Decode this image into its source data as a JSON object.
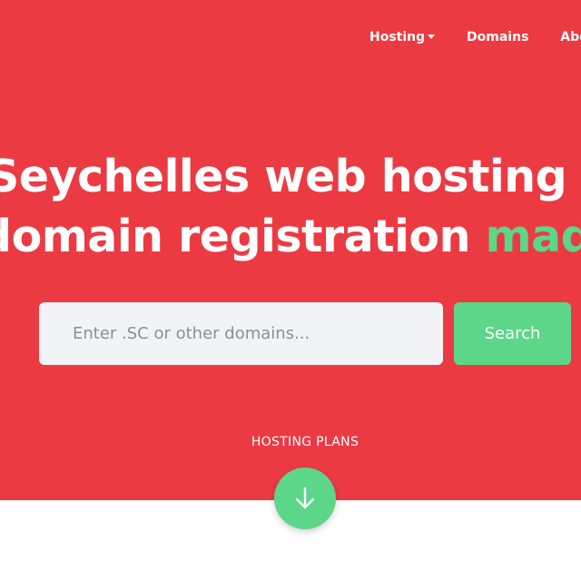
{
  "nav": {
    "hosting_label": "Hosting",
    "domains_label": "Domains",
    "about_label": "About"
  },
  "hero": {
    "headline_line1": "Seychelles web hosting and",
    "headline_line2_plain": "domain registration ",
    "headline_line2_accent": "made easy",
    "plans_label": "HOSTING PLANS"
  },
  "search": {
    "placeholder": "Enter .SC or other domains...",
    "value": "",
    "button_label": "Search"
  },
  "icons": {
    "dropdown": "caret-down-icon",
    "scroll": "arrow-down-icon"
  },
  "colors": {
    "hero_background": "#ec3a43",
    "accent_green": "#5cd689",
    "input_background": "#f1f3f6"
  }
}
